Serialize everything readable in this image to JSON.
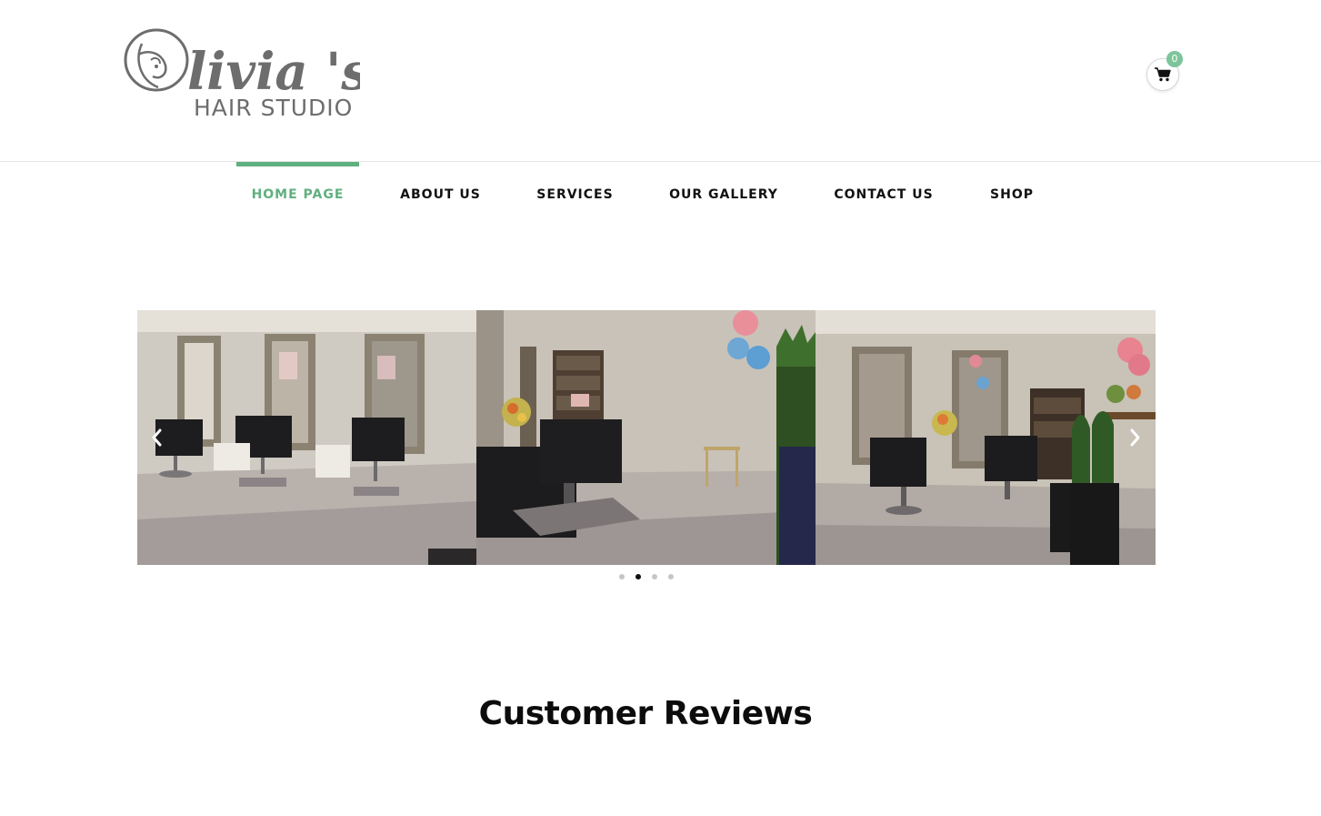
{
  "brand": {
    "logo_script": "livia 's",
    "logo_initial": "O",
    "logo_subtitle": "HAIR STUDIO"
  },
  "cart": {
    "icon": "cart-icon",
    "count": "0"
  },
  "nav": {
    "items": [
      {
        "label": "HOME PAGE",
        "active": true
      },
      {
        "label": "ABOUT US",
        "active": false
      },
      {
        "label": "SERVICES",
        "active": false
      },
      {
        "label": "OUR GALLERY",
        "active": false
      },
      {
        "label": "CONTACT US",
        "active": false
      },
      {
        "label": "SHOP",
        "active": false
      }
    ]
  },
  "carousel": {
    "slides_visible": 3,
    "prev_icon": "chevron-left-icon",
    "next_icon": "chevron-right-icon",
    "dots": 4,
    "active_dot": 2
  },
  "reviews": {
    "title": "Customer Reviews"
  },
  "colors": {
    "accent": "#5fb07f",
    "badge": "#7dc49a",
    "text": "#111111"
  }
}
